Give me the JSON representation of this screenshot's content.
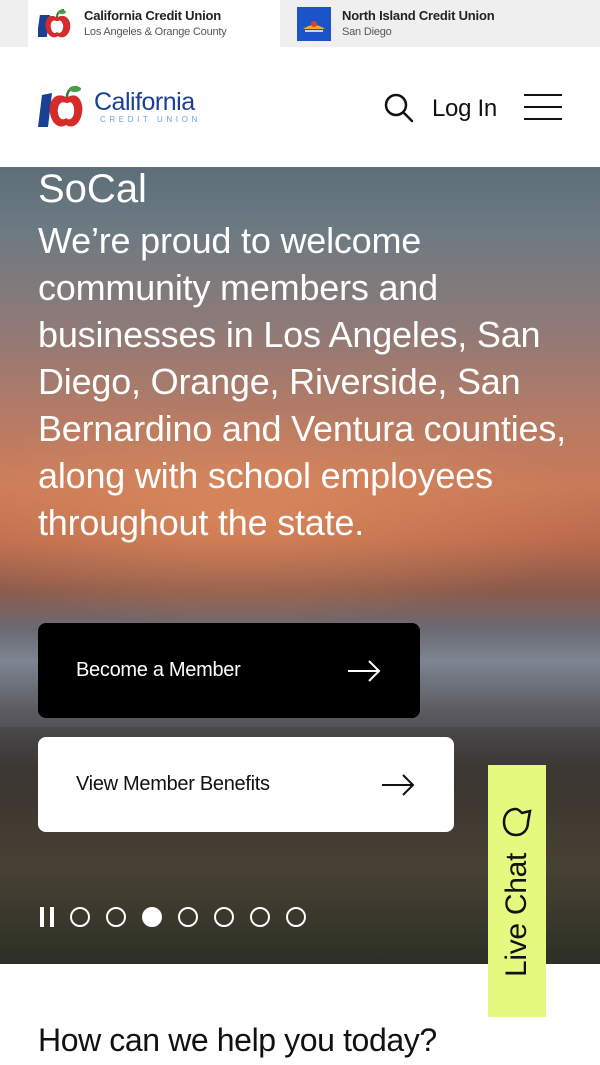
{
  "brand_switcher": {
    "items": [
      {
        "title": "California Credit Union",
        "subtitle": "Los Angeles & Orange County",
        "icon": "california-apple-logo"
      },
      {
        "title": "North Island Credit Union",
        "subtitle": "San Diego",
        "icon": "north-island-logo"
      }
    ]
  },
  "header": {
    "logo_name": "California",
    "logo_sub": "CREDIT UNION",
    "login_label": "Log In",
    "search_icon": "search-icon",
    "menu_icon": "hamburger-menu-icon"
  },
  "hero": {
    "title": "SoCal",
    "body": "We’re proud to welcome community members and businesses in Los Angeles, San Diego, Orange, Riverside, San Bernardino and Ventura counties, along with school employees throughout the state.",
    "primary_cta": "Become a Member",
    "secondary_cta": "View Member Benefits",
    "carousel": {
      "total_slides": 7,
      "active_index": 2
    }
  },
  "live_chat": {
    "label": "Live Chat",
    "icon": "chat-bubble-icon",
    "color": "#e4f97d"
  },
  "section": {
    "heading": "How can we help you today?"
  },
  "colors": {
    "brand_blue": "#1a3f93",
    "light_blue": "#6aa3d6",
    "apple_red": "#d62b2b",
    "nicu_blue": "#1a54c8"
  }
}
